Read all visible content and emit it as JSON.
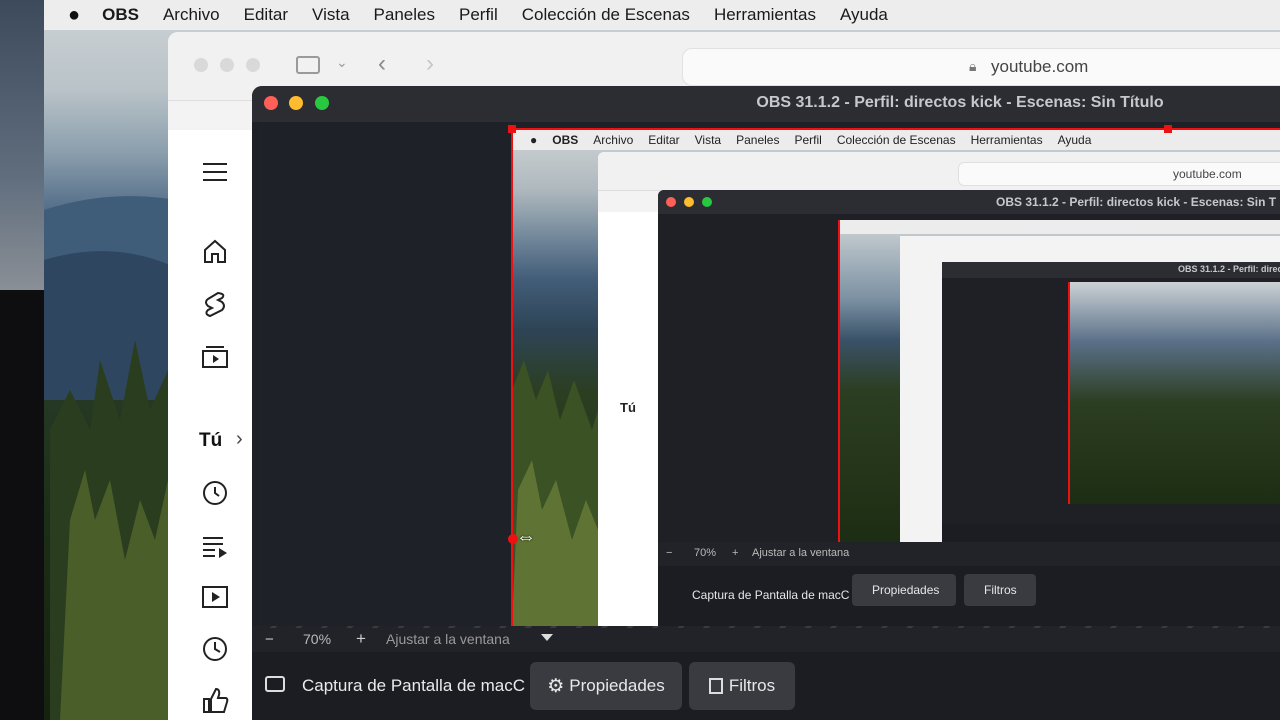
{
  "menubar": {
    "app": "OBS",
    "items": [
      "Archivo",
      "Editar",
      "Vista",
      "Paneles",
      "Perfil",
      "Colección de Escenas",
      "Herramientas",
      "Ayuda"
    ]
  },
  "safari": {
    "url": "youtube.com",
    "sidebar": {
      "you_label": "Tú"
    }
  },
  "obs": {
    "title": "OBS 31.1.2 - Perfil: directos kick - Escenas: Sin Título",
    "title_mid": "OBS 31.1.2 - Perfil: directos kick - Escenas: Sin T",
    "title_small": "OBS 31.1.2 - Perfil: direc",
    "zoom": "70%",
    "zoom_minus": "−",
    "zoom_plus": "+",
    "fit": "Ajustar a la ventana",
    "source": "Captura de Pantalla de macC",
    "properties": "Propiedades",
    "filters": "Filtros"
  },
  "colors": {
    "accent_red": "#e11111",
    "obs_bg": "#1f2026",
    "menubar": "#ededed"
  }
}
